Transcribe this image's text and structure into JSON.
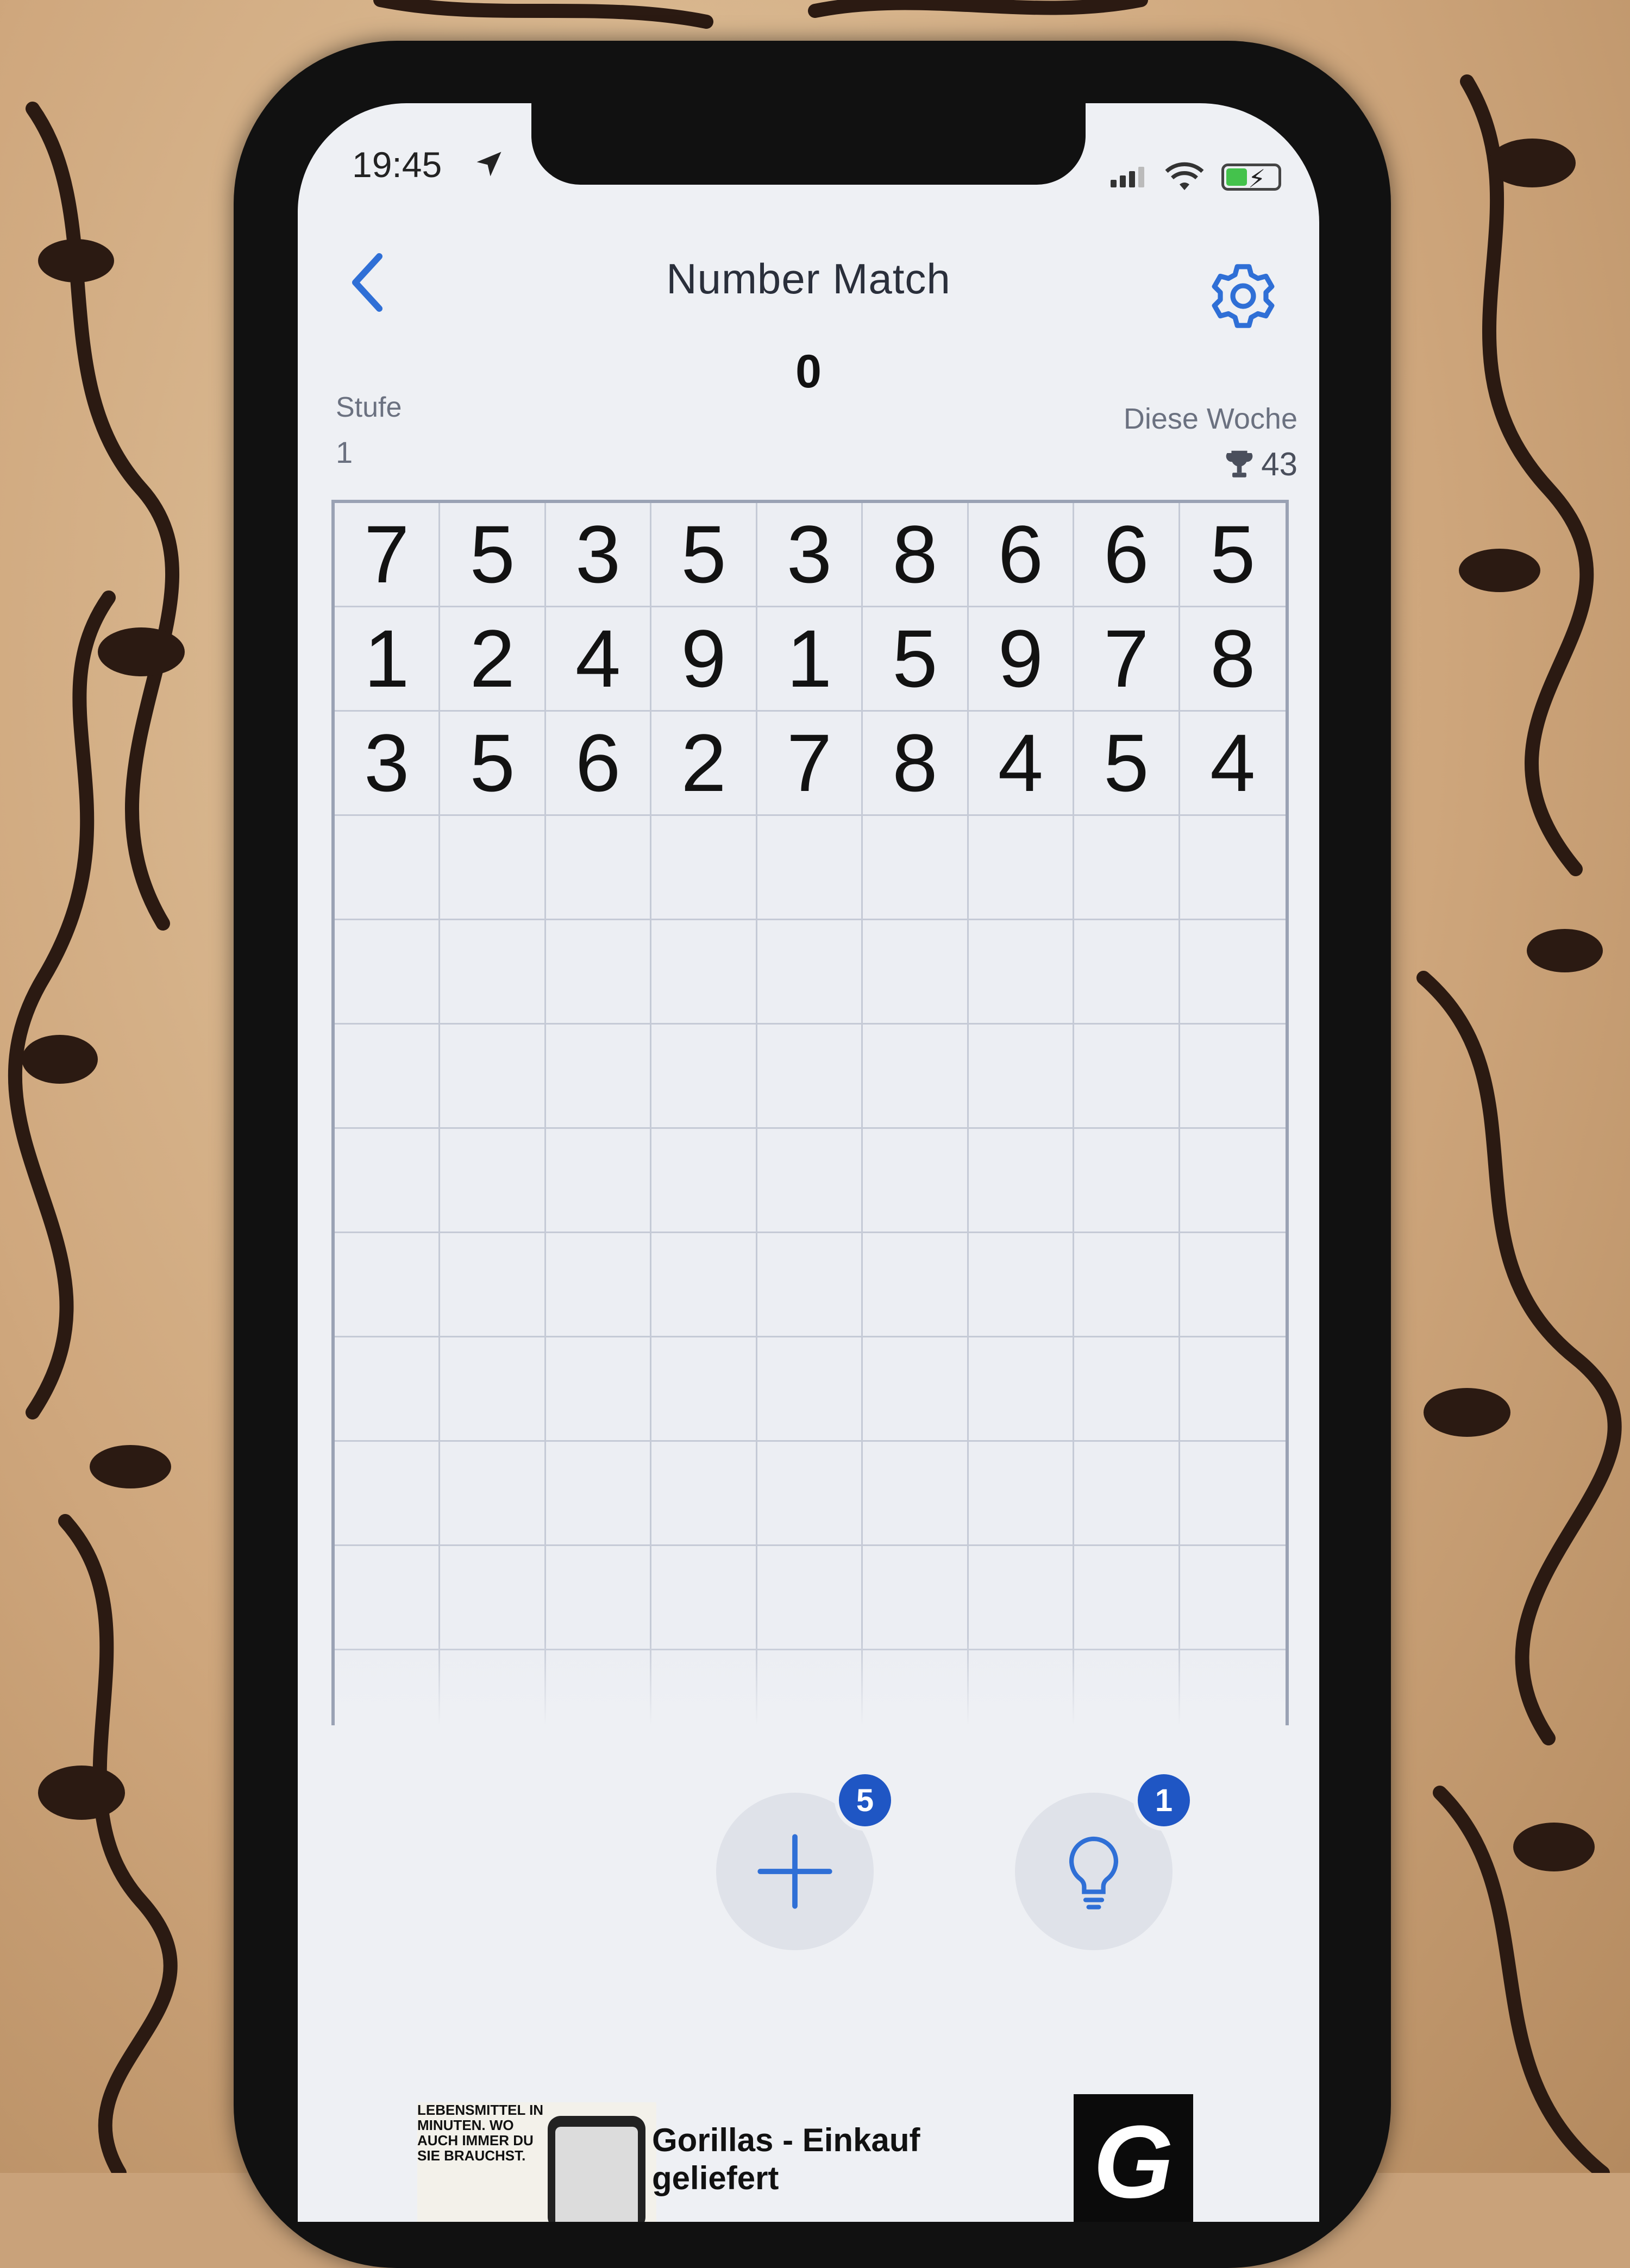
{
  "status_bar": {
    "time": "19:45"
  },
  "header": {
    "title": "Number Match",
    "score": "0"
  },
  "stats": {
    "level_label": "Stufe",
    "level_value": "1",
    "week_label": "Diese Woche",
    "week_value": "43"
  },
  "board": {
    "rows": [
      [
        "7",
        "5",
        "3",
        "5",
        "3",
        "8",
        "6",
        "6",
        "5"
      ],
      [
        "1",
        "2",
        "4",
        "9",
        "1",
        "5",
        "9",
        "7",
        "8"
      ],
      [
        "3",
        "5",
        "6",
        "2",
        "7",
        "8",
        "4",
        "5",
        "4"
      ],
      [
        "",
        "",
        "",
        "",
        "",
        "",
        "",
        "",
        ""
      ],
      [
        "",
        "",
        "",
        "",
        "",
        "",
        "",
        "",
        ""
      ],
      [
        "",
        "",
        "",
        "",
        "",
        "",
        "",
        "",
        ""
      ],
      [
        "",
        "",
        "",
        "",
        "",
        "",
        "",
        "",
        ""
      ],
      [
        "",
        "",
        "",
        "",
        "",
        "",
        "",
        "",
        ""
      ],
      [
        "",
        "",
        "",
        "",
        "",
        "",
        "",
        "",
        ""
      ],
      [
        "",
        "",
        "",
        "",
        "",
        "",
        "",
        "",
        ""
      ],
      [
        "",
        "",
        "",
        "",
        "",
        "",
        "",
        "",
        ""
      ],
      [
        "",
        "",
        "",
        "",
        "",
        "",
        "",
        "",
        ""
      ]
    ]
  },
  "actions": {
    "add_numbers": {
      "icon": "plus-icon",
      "badge": "5"
    },
    "hint": {
      "icon": "lightbulb-icon",
      "badge": "1"
    }
  },
  "ad": {
    "tagline": "LEBENSMITTEL IN MINUTEN. WO AUCH IMMER DU SIE BRAUCHST.",
    "title_line1": "Gorillas - Einkauf",
    "title_line2": "geliefert",
    "logo_text": "G"
  },
  "colors": {
    "accent": "#2f6fd6",
    "badge": "#1f56c4",
    "battery": "#44c24c"
  }
}
